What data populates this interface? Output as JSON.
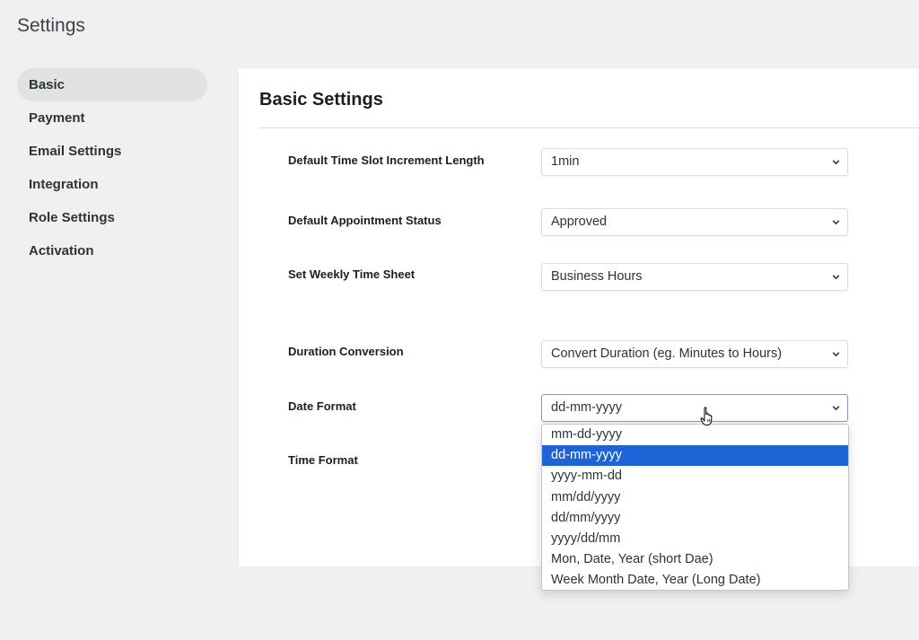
{
  "page": {
    "title": "Settings"
  },
  "sidebar": {
    "items": [
      {
        "label": "Basic",
        "active": true
      },
      {
        "label": "Payment",
        "active": false
      },
      {
        "label": "Email Settings",
        "active": false
      },
      {
        "label": "Integration",
        "active": false
      },
      {
        "label": "Role Settings",
        "active": false
      },
      {
        "label": "Activation",
        "active": false
      }
    ]
  },
  "panel": {
    "title": "Basic Settings",
    "fields": [
      {
        "label": "Default Time Slot Increment Length",
        "value": "1min"
      },
      {
        "label": "Default Appointment Status",
        "value": "Approved"
      },
      {
        "label": "Set Weekly Time Sheet",
        "value": "Business Hours"
      },
      {
        "label": "Duration Conversion",
        "value": "Convert Duration (eg. Minutes to Hours)"
      },
      {
        "label": "Date Format",
        "value": "dd-mm-yyyy"
      },
      {
        "label": "Time Format",
        "value": ""
      }
    ]
  },
  "date_format_dropdown": {
    "open": true,
    "selected": "dd-mm-yyyy",
    "options": [
      "mm-dd-yyyy",
      "dd-mm-yyyy",
      "yyyy-mm-dd",
      "mm/dd/yyyy",
      "dd/mm/yyyy",
      "yyyy/dd/mm",
      "Mon, Date, Year (short Dae)",
      "Week Month Date, Year (Long Date)"
    ]
  },
  "colors": {
    "accent": "#1f64d6",
    "background": "#f0f0f1",
    "active_item": "#e2e2e2"
  },
  "icons": {
    "select_arrow": "chevron-down-icon",
    "pointer": "hand-pointer-icon"
  }
}
